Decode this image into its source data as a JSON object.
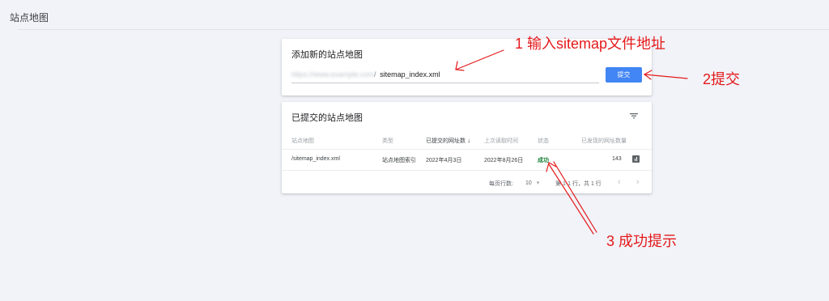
{
  "header": {
    "title": "站点地图"
  },
  "add_sitemap": {
    "title": "添加新的站点地图",
    "url_prefix": "https://www.example.com",
    "url_slash": "/",
    "input_value": "sitemap_index.xml",
    "submit_label": "提交"
  },
  "submitted": {
    "title": "已提交的站点地图",
    "columns": [
      "站点地图",
      "类型",
      "已提交的网址数",
      "上次读取时间",
      "状态",
      "已发现的网址数量"
    ],
    "sort_icon": "arrow-down-icon",
    "rows": [
      {
        "sitemap": "/sitemap_index.xml",
        "type": "站点地图索引",
        "submitted": "2022年4月3日",
        "last_read": "2022年8月26日",
        "status": "成功",
        "discovered": "143"
      }
    ],
    "pagination": {
      "rows_per_page_label": "每页行数:",
      "rows_per_page": "10",
      "range": "第 1-1 行，共 1 行"
    }
  },
  "annotations": {
    "step1": "1 输入sitemap文件地址",
    "step2": "2提交",
    "step3": "3 成功提示"
  },
  "colors": {
    "accent": "#4285f4",
    "success": "#188038",
    "annotation": "#e4191b"
  }
}
